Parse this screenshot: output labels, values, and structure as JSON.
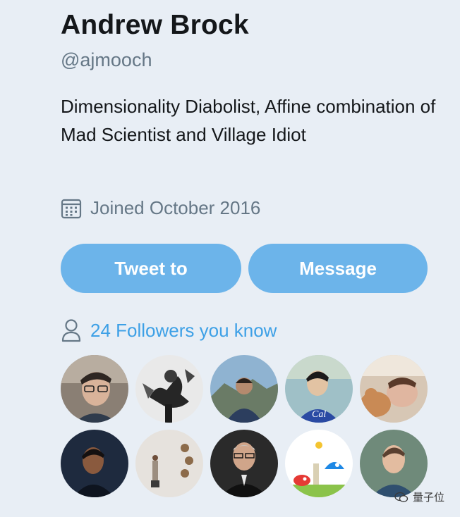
{
  "profile": {
    "name": "Andrew Brock",
    "handle": "@ajmooch",
    "bio": "Dimensionality Diabolist, Affine combination of Mad Scientist and Village Idiot",
    "joined": "Joined October 2016",
    "joined_icon": "calendar-icon"
  },
  "actions": {
    "tweet_label": "Tweet to",
    "message_label": "Message"
  },
  "followers": {
    "label": "24 Followers you know",
    "icon": "person-icon",
    "avatars": [
      {
        "name": "avatar-1"
      },
      {
        "name": "avatar-2"
      },
      {
        "name": "avatar-3"
      },
      {
        "name": "avatar-4"
      },
      {
        "name": "avatar-5"
      },
      {
        "name": "avatar-6"
      },
      {
        "name": "avatar-7"
      },
      {
        "name": "avatar-8"
      },
      {
        "name": "avatar-9"
      },
      {
        "name": "avatar-10"
      }
    ]
  },
  "watermark": {
    "text": "量子位",
    "icon": "wechat-icon"
  },
  "colors": {
    "background": "#e8eef5",
    "button": "#6cb4ea",
    "link": "#3da0e6",
    "secondary_text": "#657786"
  }
}
